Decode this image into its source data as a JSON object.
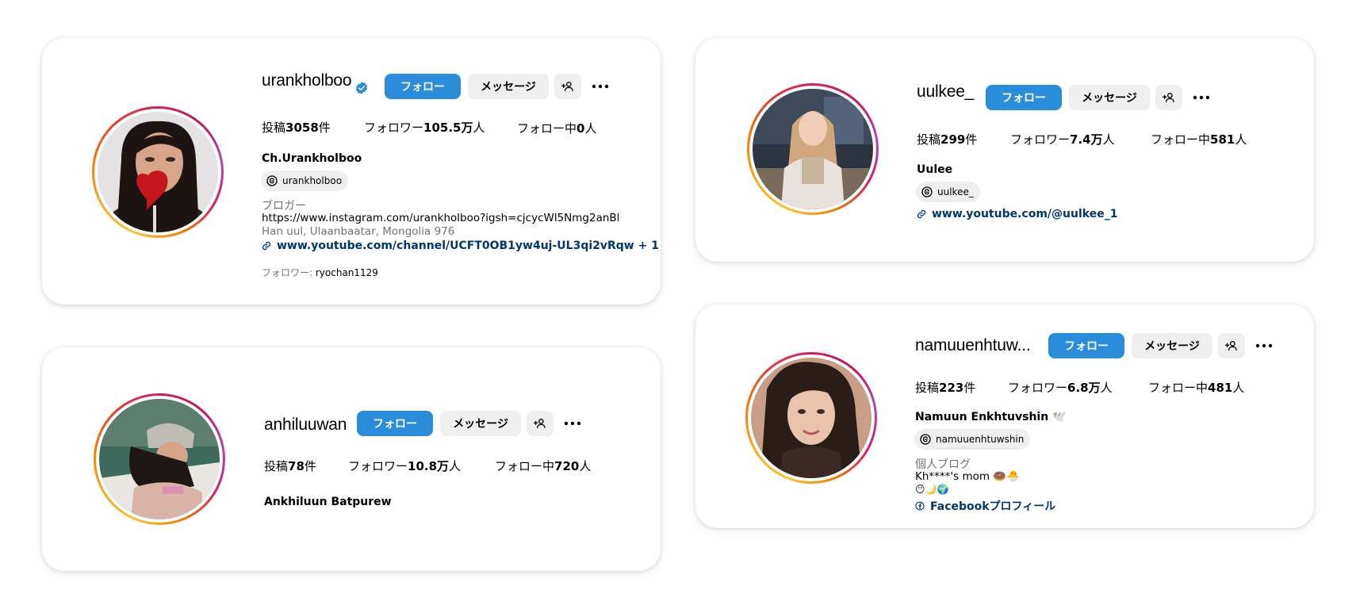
{
  "profiles": [
    {
      "username": "urankholboo",
      "verified": true,
      "follow_label": "フォロー",
      "message_label": "メッセージ",
      "stats": {
        "posts_prefix": "投稿",
        "posts": "3058",
        "posts_suffix": "件",
        "followers_prefix": "フォロワー",
        "followers": "105.5万",
        "followers_suffix": "人",
        "following_prefix": "フォロー中",
        "following": "0",
        "following_suffix": "人"
      },
      "full_name": "Ch.Urankholboo",
      "threads_handle": "urankholboo",
      "category": "ブロガー",
      "bio_lines": [
        "https://www.instagram.com/urankholboo?igsh=cjcycWl5Nmg2anBl"
      ],
      "location": "Han uul, Ulaanbaatar, Mongolia 976",
      "link": "www.youtube.com/channel/UCFT0OB1yw4uj-UL3qi2vRqw + 1",
      "followed_by_label": "フォロワー: ",
      "followed_by": "ryochan1129"
    },
    {
      "username": "uulkee_",
      "verified": false,
      "follow_label": "フォロー",
      "message_label": "メッセージ",
      "stats": {
        "posts_prefix": "投稿",
        "posts": "299",
        "posts_suffix": "件",
        "followers_prefix": "フォロワー",
        "followers": "7.4万",
        "followers_suffix": "人",
        "following_prefix": "フォロー中",
        "following": "581",
        "following_suffix": "人"
      },
      "full_name": "Uulee",
      "threads_handle": "uulkee_",
      "link": "www.youtube.com/@uulkee_1"
    },
    {
      "username": "anhiluuwan",
      "verified": false,
      "follow_label": "フォロー",
      "message_label": "メッセージ",
      "stats": {
        "posts_prefix": "投稿",
        "posts": "78",
        "posts_suffix": "件",
        "followers_prefix": "フォロワー",
        "followers": "10.8万",
        "followers_suffix": "人",
        "following_prefix": "フォロー中",
        "following": "720",
        "following_suffix": "人"
      },
      "full_name": "Ankhiluun Batpurew"
    },
    {
      "username": "namuuenhtuw...",
      "verified": false,
      "follow_label": "フォロー",
      "message_label": "メッセージ",
      "stats": {
        "posts_prefix": "投稿",
        "posts": "223",
        "posts_suffix": "件",
        "followers_prefix": "フォロワー",
        "followers": "6.8万",
        "followers_suffix": "人",
        "following_prefix": "フォロー中",
        "following": "481",
        "following_suffix": "人"
      },
      "full_name": "Namuun Enkhtuvshin 🕊️",
      "threads_handle": "namuuenhtuwshin",
      "category": "個人ブログ",
      "bio_lines": [
        "Kh****'s mom 🍩🐣",
        "😶🌙🌍"
      ],
      "link": "Facebookプロフィール"
    }
  ],
  "colors": {
    "follow_blue": "#2a8dd9",
    "link_navy": "#00376b",
    "muted_gray": "#737373",
    "chip_bg": "#efefef"
  }
}
